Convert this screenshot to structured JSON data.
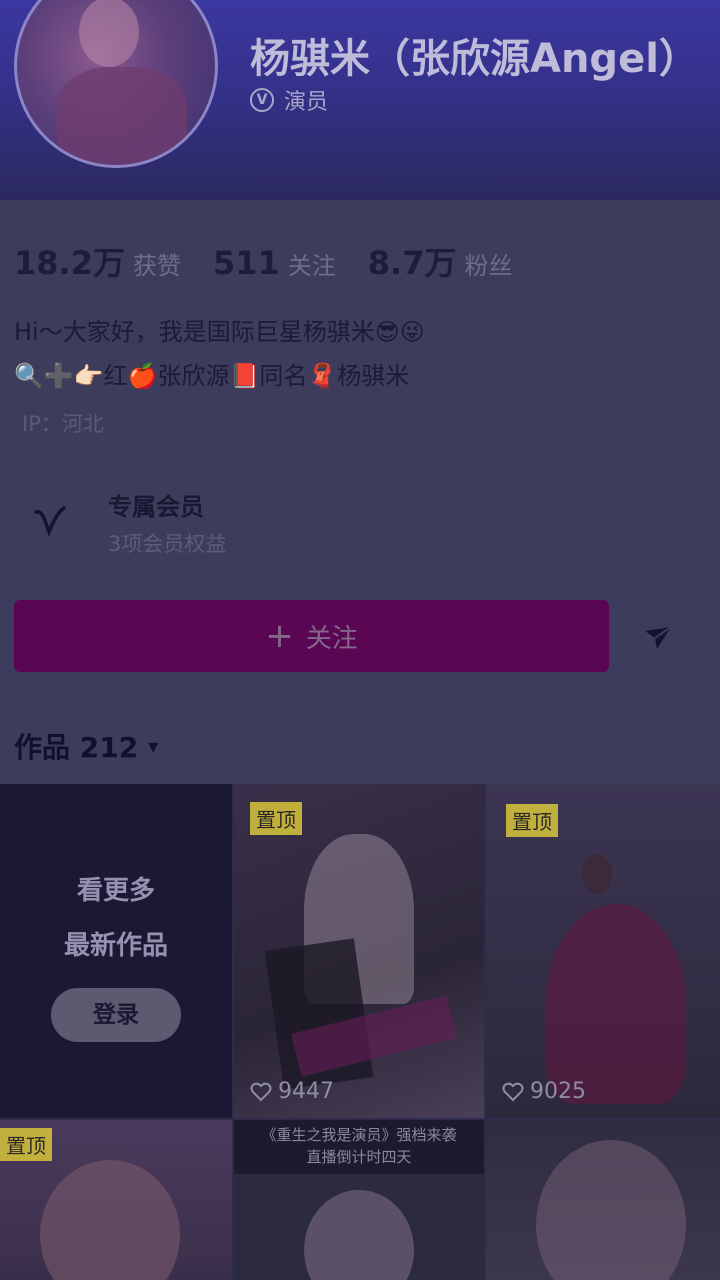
{
  "profile": {
    "name": "杨骐米（张欣源Angel）",
    "role": "演员",
    "badge": "V"
  },
  "stats": [
    {
      "value": "18.2万",
      "label": "获赞"
    },
    {
      "value": "511",
      "label": "关注"
    },
    {
      "value": "8.7万",
      "label": "粉丝"
    }
  ],
  "bio": {
    "line1": "Hi～大家好，我是国际巨星杨骐米😎😜",
    "line2": "🔍➕👉🏻红🍎张欣源📕同名🧣杨骐米",
    "ip": "IP：河北"
  },
  "vip": {
    "title": "专属会员",
    "subtitle": "3项会员权益",
    "icon": "v-logo-icon"
  },
  "actions": {
    "follow_label": "关注",
    "follow_plus": "+",
    "share_icon": "send-icon"
  },
  "works": {
    "title": "作品 212",
    "caret": "▾"
  },
  "grid": {
    "more_line1": "看更多",
    "more_line2": "最新作品",
    "login_label": "登录",
    "pin_label": "置顶",
    "tiles": [
      {
        "likes": "9447",
        "pinned": true
      },
      {
        "likes": "9025",
        "pinned": true
      },
      {
        "pinned": true
      },
      {
        "caption": "《重生之我是演员》强档来袭\n直播倒计时四天"
      },
      {}
    ]
  },
  "colors": {
    "follow_button": "#5a0652",
    "header_accent": "#3b37a0",
    "pin_badge": "#d8c63a"
  }
}
